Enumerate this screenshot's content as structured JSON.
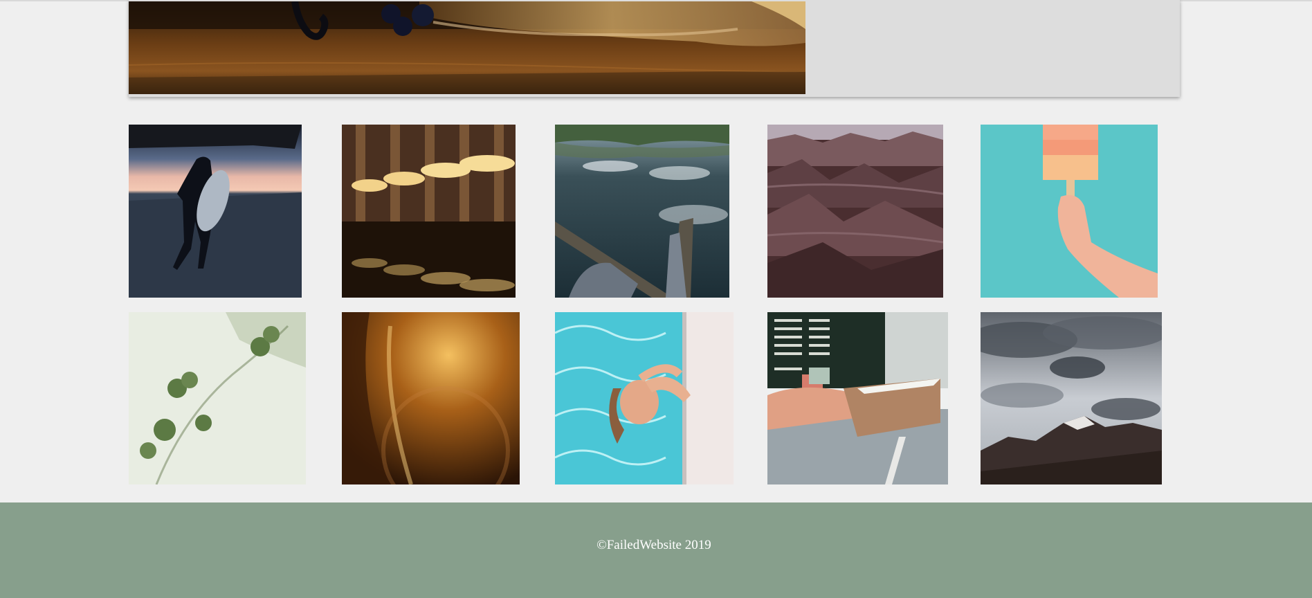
{
  "hero": {
    "image": "rustic-table-burlap-photo"
  },
  "gallery": {
    "images": [
      "surfer-silhouette-beach-photo",
      "evening-cafe-reflection-photo",
      "lake-feet-reflection-photo",
      "eroded-badlands-photo",
      "popsicle-teal-wall-photo",
      "green-leaves-shadow-photo",
      "golden-hair-backlight-photo",
      "woman-swimming-pool-photo",
      "cafe-counter-handoff-photo",
      "cloudy-mountain-sky-photo"
    ]
  },
  "footer": {
    "copyright": "©FailedWebsite 2019",
    "background": "#879f8c"
  }
}
